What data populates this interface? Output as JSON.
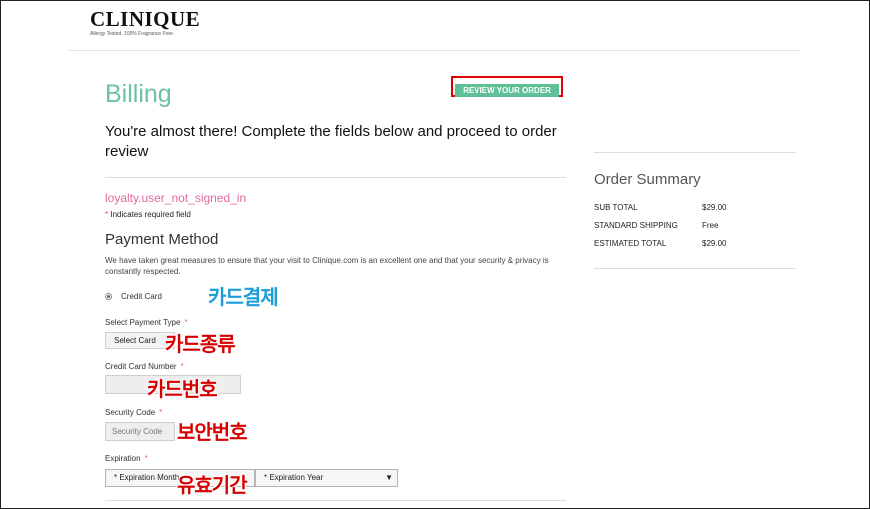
{
  "brand": {
    "name": "CLINIQUE",
    "tagline": "Allergy Tested. 100% Fragrance Free."
  },
  "page": {
    "title": "Billing",
    "review_button": "REVIEW YOUR ORDER",
    "intro": "You're almost there! Complete the fields below and proceed to order review"
  },
  "loyalty_message": "loyalty.user_not_signed_in",
  "required_note": {
    "star": "*",
    "text": "Indicates required field"
  },
  "payment": {
    "title": "Payment Method",
    "description": "We have taken great measures to ensure that your visit to Clinique.com is an excellent one and that your security & privacy is constantly respected.",
    "option_label": "Credit Card",
    "payment_type_label": "Select Payment Type",
    "payment_type_value": "Select Card",
    "card_number_label": "Credit Card Number",
    "security_label": "Security Code",
    "security_placeholder": "Security Code",
    "expiration_label": "Expiration",
    "exp_month_value": "* Expiration Month",
    "exp_year_value": "* Expiration Year",
    "required_star": "*"
  },
  "annotations": {
    "credit_card": "카드결제",
    "card_type": "카드종류",
    "card_number": "카드번호",
    "security": "보안번호",
    "expiration": "유효기간"
  },
  "summary": {
    "title": "Order Summary",
    "rows": [
      {
        "label": "SUB TOTAL",
        "value": "$29.00"
      },
      {
        "label": "STANDARD SHIPPING",
        "value": "Free"
      },
      {
        "label": "ESTIMATED TOTAL",
        "value": "$29.00"
      }
    ]
  },
  "colors": {
    "title_green": "#6cc2a4",
    "button_green": "#5fbf96",
    "highlight_red": "#e00000",
    "loyalty_pink": "#e06aa0"
  }
}
